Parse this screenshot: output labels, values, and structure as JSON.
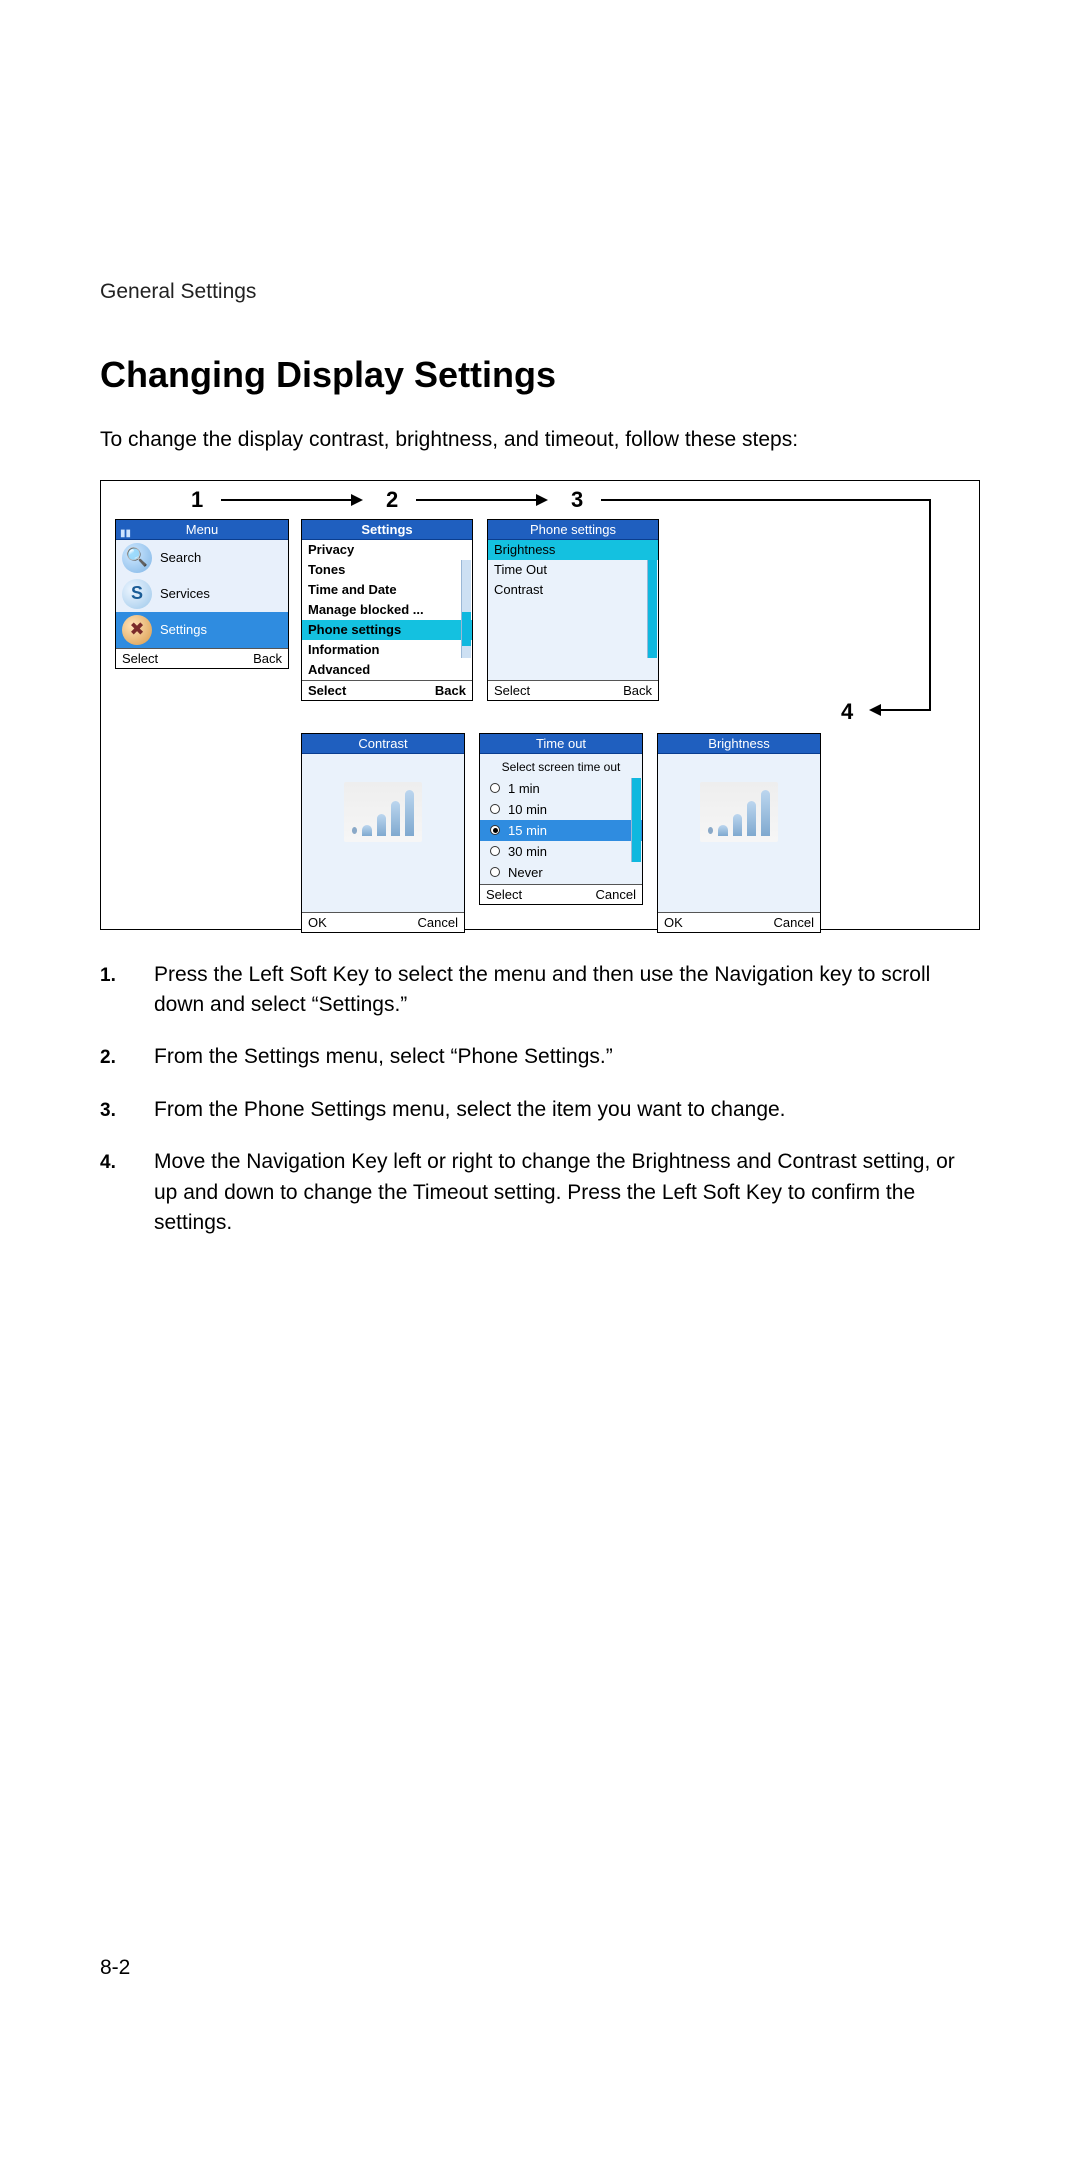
{
  "section_label": "General Settings",
  "heading": "Changing Display Settings",
  "intro": "To change the display contrast, brightness, and timeout, follow these steps:",
  "step_numbers": {
    "s1": "1",
    "s2": "2",
    "s3": "3",
    "s4": "4"
  },
  "screen1": {
    "title": "Menu",
    "items": {
      "search": "Search",
      "services": "Services",
      "settings": "Settings"
    },
    "left": "Select",
    "right": "Back"
  },
  "screen2": {
    "title": "Settings",
    "items": {
      "privacy": "Privacy",
      "tones": "Tones",
      "timedate": "Time and Date",
      "blocked": "Manage blocked ...",
      "phone": "Phone settings",
      "info": "Information",
      "advanced": "Advanced"
    },
    "left": "Select",
    "right": "Back"
  },
  "screen3": {
    "title": "Phone settings",
    "items": {
      "brightness": "Brightness",
      "timeout": "Time Out",
      "contrast": "Contrast"
    },
    "left": "Select",
    "right": "Back"
  },
  "screen_contrast": {
    "title": "Contrast",
    "left": "OK",
    "right": "Cancel"
  },
  "screen_timeout": {
    "title": "Time out",
    "subhead": "Select screen time out",
    "options": {
      "o1": "1 min",
      "o2": "10 min",
      "o3": "15 min",
      "o4": "30 min",
      "o5": "Never"
    },
    "left": "Select",
    "right": "Cancel"
  },
  "screen_brightness": {
    "title": "Brightness",
    "left": "OK",
    "right": "Cancel"
  },
  "instructions": {
    "n1": "1.",
    "t1": "Press the Left Soft Key to select the menu and then use the Navigation key to scroll down and select “Settings.”",
    "n2": "2.",
    "t2": "From the Settings menu, select “Phone Settings.”",
    "n3": "3.",
    "t3": "From the Phone Settings menu, select the item you want to change.",
    "n4": "4.",
    "t4": "Move the Navigation Key left or right to change the Brightness and Contrast setting, or up and down to change the Timeout setting. Press the Left Soft Key to confirm the settings."
  },
  "page_number": "8-2"
}
